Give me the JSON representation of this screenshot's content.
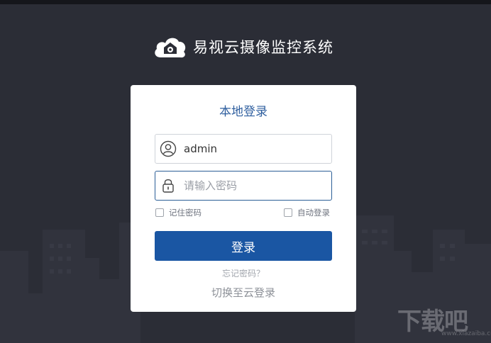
{
  "app": {
    "title": "易视云摄像监控系统"
  },
  "login": {
    "title": "本地登录",
    "username_value": "admin",
    "password_placeholder": "请输入密码",
    "remember_label": "记住密码",
    "autologin_label": "自动登录",
    "submit_label": "登录",
    "forgot_label": "忘记密码？",
    "switch_label": "切换至云登录",
    "remember_checked": false,
    "autologin_checked": false
  },
  "watermark": {
    "text": "下载吧",
    "sub": "www.xiazaiba.com"
  },
  "colors": {
    "background": "#2b2d36",
    "accent": "#1a56a3",
    "title": "#2f5f9f"
  },
  "icons": {
    "brand": "cloud-camera-logo-icon",
    "user": "user-icon",
    "password": "lock-icon"
  }
}
